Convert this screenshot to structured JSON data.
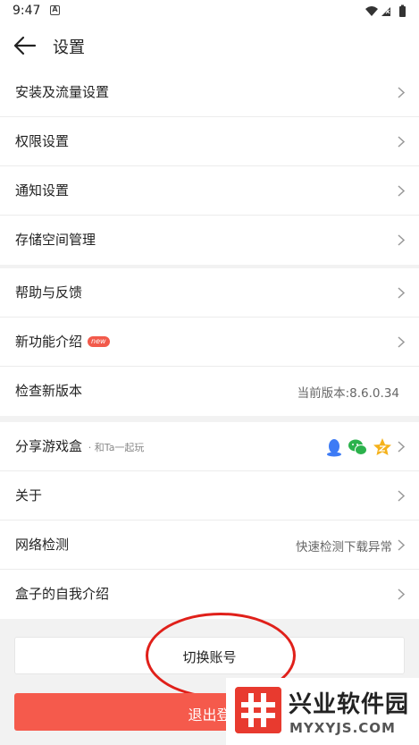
{
  "status_bar": {
    "time": "9:47",
    "notification_icon": "A"
  },
  "header": {
    "title": "设置",
    "back_icon": "arrow-left-icon"
  },
  "groups": [
    {
      "items": [
        {
          "label": "安装及流量设置"
        },
        {
          "label": "权限设置"
        },
        {
          "label": "通知设置"
        },
        {
          "label": "存储空间管理"
        }
      ]
    },
    {
      "items": [
        {
          "label": "帮助与反馈"
        },
        {
          "label": "新功能介绍",
          "badge": "new"
        },
        {
          "label": "检查新版本",
          "value": "当前版本:8.6.0.34"
        }
      ]
    },
    {
      "items": [
        {
          "label": "分享游戏盒",
          "sub": "· 和Ta一起玩",
          "icons": [
            "qq-icon",
            "wechat-icon",
            "qzone-icon"
          ]
        },
        {
          "label": "关于"
        },
        {
          "label": "网络检测",
          "value": "快速检测下载异常"
        },
        {
          "label": "盒子的自我介绍"
        }
      ]
    }
  ],
  "buttons": {
    "switch_account": "切换账号",
    "logout": "退出登"
  },
  "watermark": {
    "title": "兴业软件园",
    "url": "MYXYJS.COM"
  },
  "colors": {
    "accent": "#f55a4c",
    "annotation": "#e0201a",
    "badge": "#f25a4b"
  }
}
